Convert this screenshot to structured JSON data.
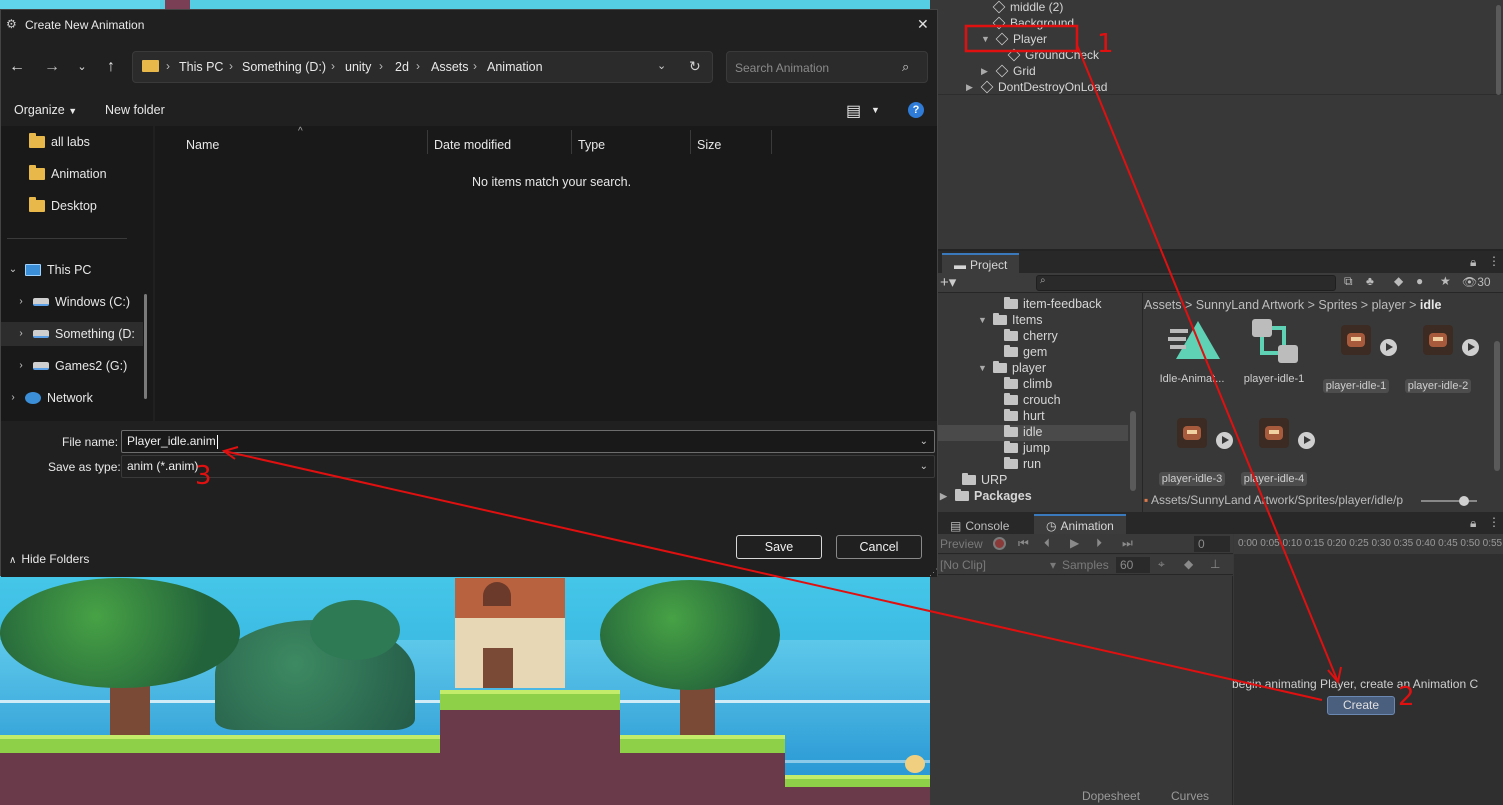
{
  "dialog": {
    "title": "Create New Animation",
    "close": "✕",
    "address": [
      "This PC",
      "Something (D:)",
      "unity",
      "2d",
      "Assets",
      "Animation"
    ],
    "search_placeholder": "Search Animation",
    "organize": "Organize",
    "new_folder": "New folder",
    "help": "?",
    "sidebar": [
      {
        "label": "all labs",
        "icon": "folder-icon"
      },
      {
        "label": "Animation",
        "icon": "folder-icon"
      },
      {
        "label": "Desktop",
        "icon": "folder-icon"
      },
      {
        "label": "This PC",
        "icon": "pc-icon"
      },
      {
        "label": "Windows (C:)",
        "icon": "drive-icon"
      },
      {
        "label": "Something (D:",
        "icon": "drive-icon"
      },
      {
        "label": "Games2 (G:)",
        "icon": "drive-icon"
      },
      {
        "label": "Network",
        "icon": "network-icon"
      }
    ],
    "columns": [
      "Name",
      "Date modified",
      "Type",
      "Size"
    ],
    "empty_message": "No items match your search.",
    "file_name_label": "File name:",
    "file_name_value": "Player_idle.anim",
    "save_type_label": "Save as type:",
    "save_type_value": "anim (*.anim)",
    "hide_folders": "Hide Folders",
    "save": "Save",
    "cancel": "Cancel"
  },
  "hierarchy": {
    "items": [
      "middle (2)",
      "Background",
      "Player",
      "GroundCheck",
      "Grid",
      "DontDestroyOnLoad"
    ]
  },
  "project": {
    "tab": "Project",
    "count": "30",
    "tree": [
      "item-feedback",
      "Items",
      "cherry",
      "gem",
      "player",
      "climb",
      "crouch",
      "hurt",
      "idle",
      "jump",
      "run",
      "URP",
      "Packages"
    ],
    "breadcrumb": [
      "Assets",
      "SunnyLand Artwork",
      "Sprites",
      "player",
      "idle"
    ],
    "assets": [
      "Idle-Animat...",
      "player-idle-1",
      "player-idle-1",
      "player-idle-2",
      "player-idle-3",
      "player-idle-4"
    ],
    "path": "Assets/SunnyLand Artwork/Sprites/player/idle/p"
  },
  "animation": {
    "tabs": [
      "Console",
      "Animation"
    ],
    "preview": "Preview",
    "frame": "0",
    "timeline": "0:00 0:05 0:10 0:15 0:20 0:25 0:30 0:35 0:40 0:45 0:50 0:55",
    "clip": "[No Clip]",
    "samples_label": "Samples",
    "samples_value": "60",
    "begin_text": "begin animating Player, create an Animation C",
    "create": "Create",
    "bottom_tabs": [
      "Dopesheet",
      "Curves"
    ]
  },
  "annotations": {
    "one": "1",
    "two": "2",
    "three": "3",
    "color": "#e01010"
  }
}
